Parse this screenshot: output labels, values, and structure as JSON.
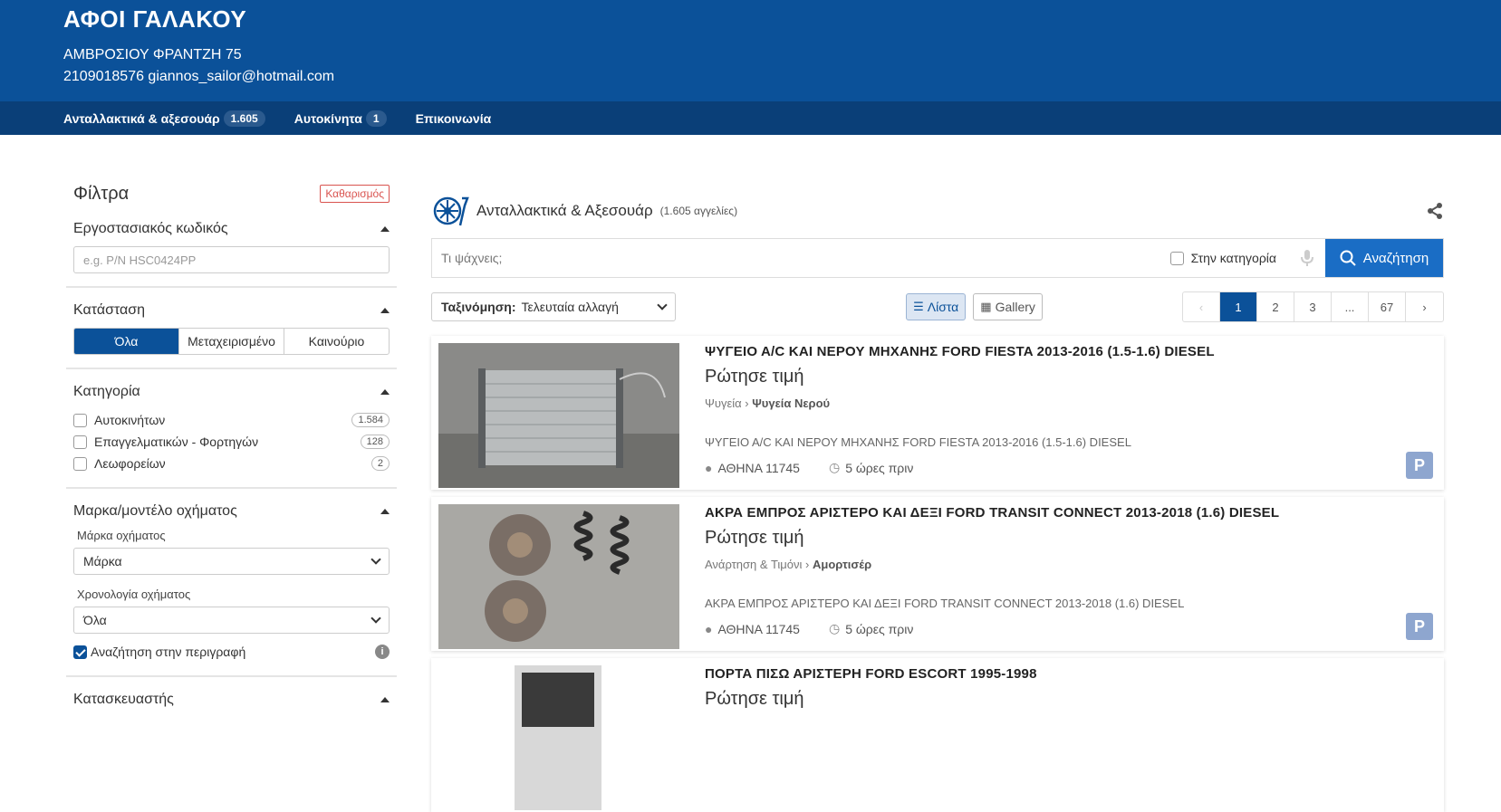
{
  "header": {
    "name": "ΑΦΟΙ ΓΑΛΑΚΟΥ",
    "address": "ΑΜΒΡΟΣΙΟΥ ΦΡΑΝΤΖΗ 75",
    "contact": "2109018576 giannos_sailor@hotmail.com"
  },
  "nav": [
    {
      "label": "Ανταλλακτικά & αξεσουάρ",
      "badge": "1.605"
    },
    {
      "label": "Αυτοκίνητα",
      "badge": "1"
    },
    {
      "label": "Επικοινωνία"
    }
  ],
  "sidebar": {
    "title": "Φίλτρα",
    "clear": "Καθαρισμός",
    "partcode": {
      "title": "Εργοστασιακός κωδικός",
      "placeholder": "e.g. P/N HSC0424PP"
    },
    "condition": {
      "title": "Κατάσταση",
      "options": [
        "Όλα",
        "Μεταχειρισμένο",
        "Καινούριο"
      ]
    },
    "category": {
      "title": "Κατηγορία",
      "items": [
        {
          "label": "Αυτοκινήτων",
          "count": "1.584"
        },
        {
          "label": "Επαγγελματικών - Φορτηγών",
          "count": "128"
        },
        {
          "label": "Λεωφορείων",
          "count": "2"
        }
      ]
    },
    "make": {
      "title": "Μαρκα/μοντέλο οχήματος",
      "make_label": "Μάρκα οχήματος",
      "make_value": "Μάρκα",
      "year_label": "Χρονολογία οχήματος",
      "year_value": "Όλα",
      "desc_search": "Αναζήτηση στην περιγραφή"
    },
    "manufacturer": {
      "title": "Κατασκευαστής"
    }
  },
  "main": {
    "title": "Ανταλλακτικά & Αξεσουάρ",
    "count": "(1.605 αγγελίες)",
    "search_placeholder": "Τι ψάχνεις;",
    "in_category": "Στην κατηγορία",
    "search_btn": "Αναζήτηση",
    "sort_label": "Ταξινόμηση:",
    "sort_value": "Τελευταία αλλαγή",
    "view_list": "Λίστα",
    "view_gallery": "Gallery",
    "pages": [
      "1",
      "2",
      "3",
      "...",
      "67"
    ],
    "listings": [
      {
        "title": "ΨΥΓΕΙΟ Α/C ΚΑΙ ΝΕΡΟΥ ΜΗΧΑΝΗΣ FORD FIESTA 2013-2016 (1.5-1.6) DIESEL",
        "price": "Ρώτησε τιμή",
        "cat1": "Ψυγεία",
        "cat2": "Ψυγεία Νερού",
        "desc": "ΨΥΓΕΙΟ Α/C ΚΑΙ ΝΕΡΟΥ ΜΗΧΑΝΗΣ FORD FIESTA 2013-2016 (1.5-1.6) DIESEL",
        "location": "ΑΘΗΝΑ 11745",
        "time": "5 ώρες πριν"
      },
      {
        "title": "ΑΚΡΑ ΕΜΠΡΟΣ ΑΡΙΣΤΕΡΟ ΚΑΙ ΔΕΞΙ FORD TRANSIT CONNECT 2013-2018 (1.6) DIESEL",
        "price": "Ρώτησε τιμή",
        "cat1": "Ανάρτηση & Τιμόνι",
        "cat2": "Αμορτισέρ",
        "desc": "ΑΚΡΑ ΕΜΠΡΟΣ ΑΡΙΣΤΕΡΟ ΚΑΙ ΔΕΞΙ FORD TRANSIT CONNECT 2013-2018 (1.6) DIESEL",
        "location": "ΑΘΗΝΑ 11745",
        "time": "5 ώρες πριν"
      },
      {
        "title": "ΠΟΡΤΑ ΠΙΣΩ ΑΡΙΣΤΕΡΗ FORD ESCORT 1995-1998",
        "price": "Ρώτησε τιμή"
      }
    ],
    "p_badge": "P"
  }
}
